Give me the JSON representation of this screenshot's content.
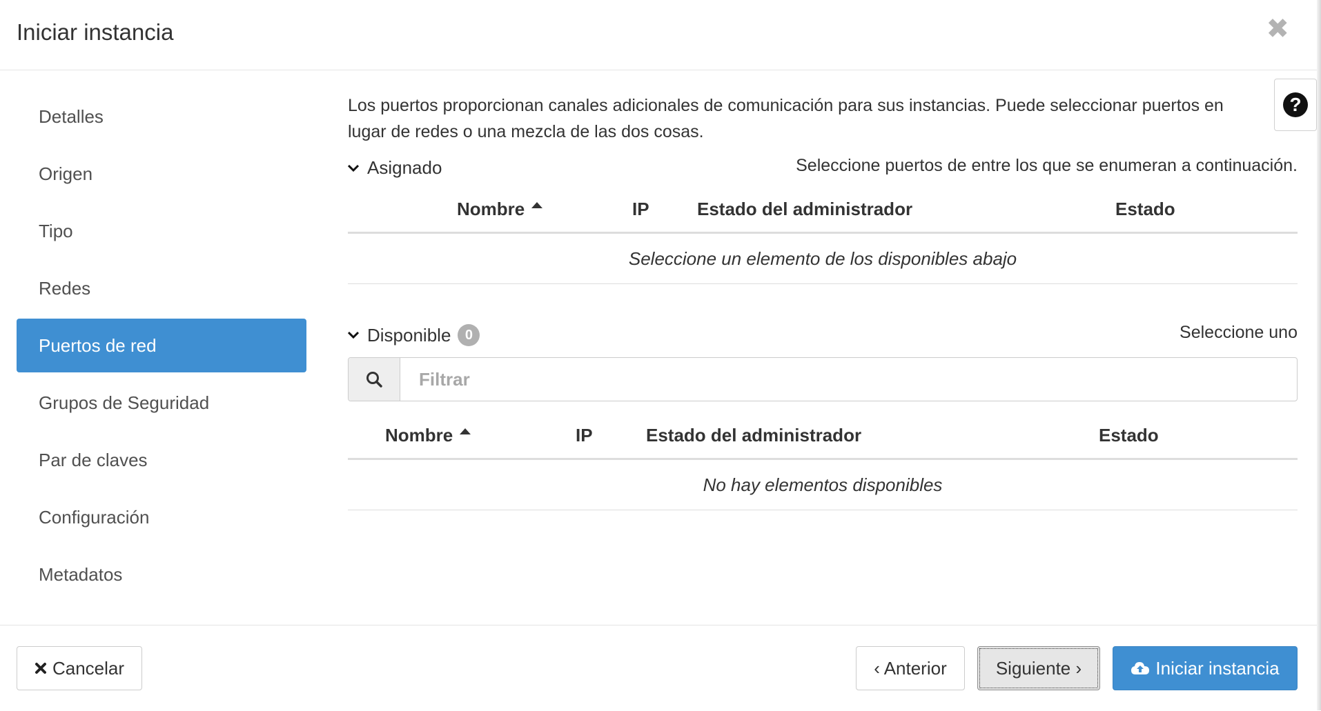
{
  "modal": {
    "title": "Iniciar instancia",
    "close_icon": "close-icon"
  },
  "sidebar": {
    "items": [
      {
        "label": "Detalles"
      },
      {
        "label": "Origen"
      },
      {
        "label": "Tipo"
      },
      {
        "label": "Redes"
      },
      {
        "label": "Puertos de red",
        "active": true
      },
      {
        "label": "Grupos de Seguridad"
      },
      {
        "label": "Par de claves"
      },
      {
        "label": "Configuración"
      },
      {
        "label": "Metadatos"
      }
    ]
  },
  "main": {
    "description": "Los puertos proporcionan canales adicionales de comunicación para sus instancias. Puede seleccionar puertos en lugar de redes o una mezcla de las dos cosas.",
    "help_icon": "question-circle-icon",
    "allocated": {
      "label": "Asignado",
      "hint": "Seleccione puertos de entre los que se enumeran a continuación.",
      "columns": [
        "Nombre",
        "IP",
        "Estado del administrador",
        "Estado"
      ],
      "empty_message": "Seleccione un elemento de los disponibles abajo"
    },
    "available": {
      "label": "Disponible",
      "count": "0",
      "hint": "Seleccione uno",
      "filter_placeholder": "Filtrar",
      "filter_value": "",
      "columns": [
        "Nombre",
        "IP",
        "Estado del administrador",
        "Estado"
      ],
      "empty_message": "No hay elementos disponibles"
    }
  },
  "footer": {
    "cancel_label": "Cancelar",
    "prev_label": "‹ Anterior",
    "next_label": "Siguiente ›",
    "launch_label": "Iniciar instancia"
  },
  "colors": {
    "accent": "#3f8fd2",
    "border": "#dddddd",
    "badge": "#b0b0b0"
  }
}
